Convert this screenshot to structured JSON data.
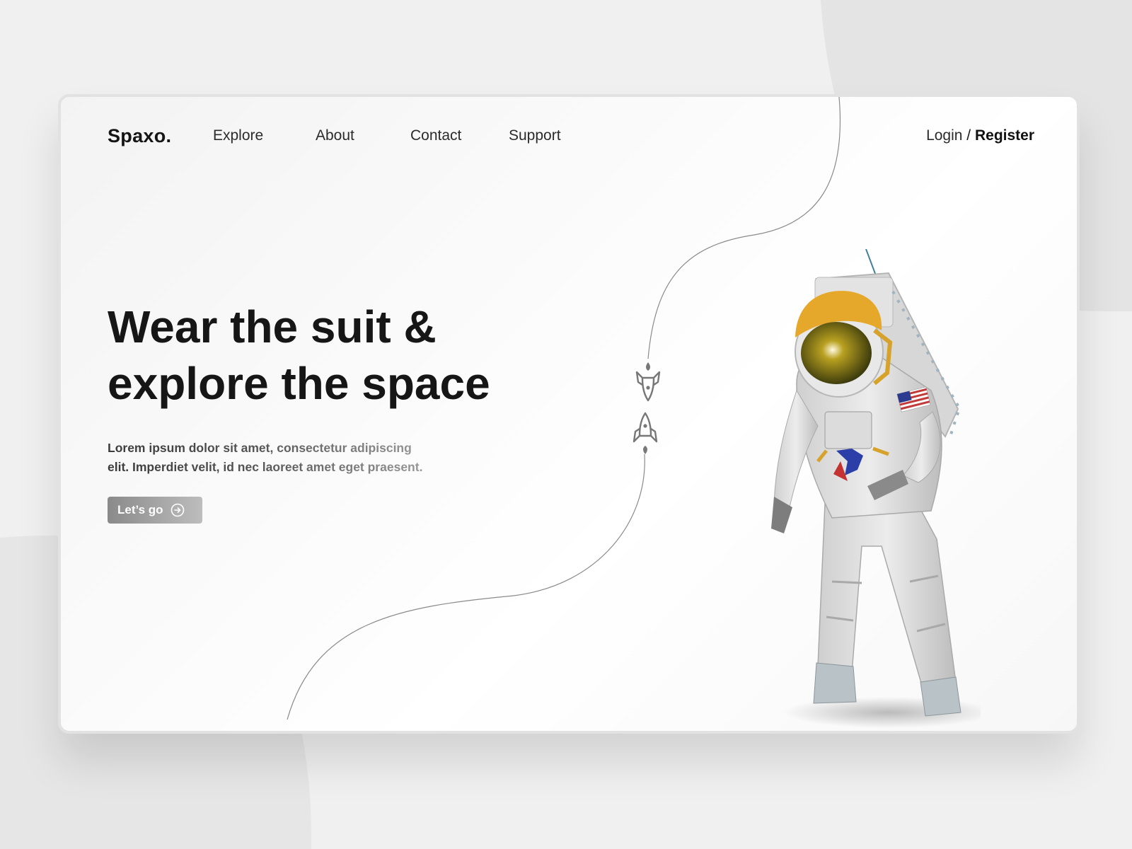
{
  "header": {
    "logo": "Spaxo.",
    "nav": [
      "Explore",
      "About",
      "Contact",
      "Support"
    ],
    "login": "Login",
    "separator": " / ",
    "register": "Register"
  },
  "hero": {
    "headline_line1": "Wear the suit &",
    "headline_line2": "explore the space",
    "description_line1": "Lorem ipsum dolor sit amet, consectetur adipiscing",
    "description_line2": "elit. Imperdiet velit, id nec laoreet amet eget praesent.",
    "cta_label": "Let’s go"
  },
  "icons": {
    "cta_icon": "arrow-right-circle-icon",
    "rocket_down": "rocket-down-icon",
    "rocket_up": "rocket-up-icon"
  },
  "colors": {
    "text": "#161616",
    "button": "#9a9a9a",
    "suit": "#e2e2e2",
    "helmet": "#e8a82c",
    "visor": "#5a5a10"
  }
}
